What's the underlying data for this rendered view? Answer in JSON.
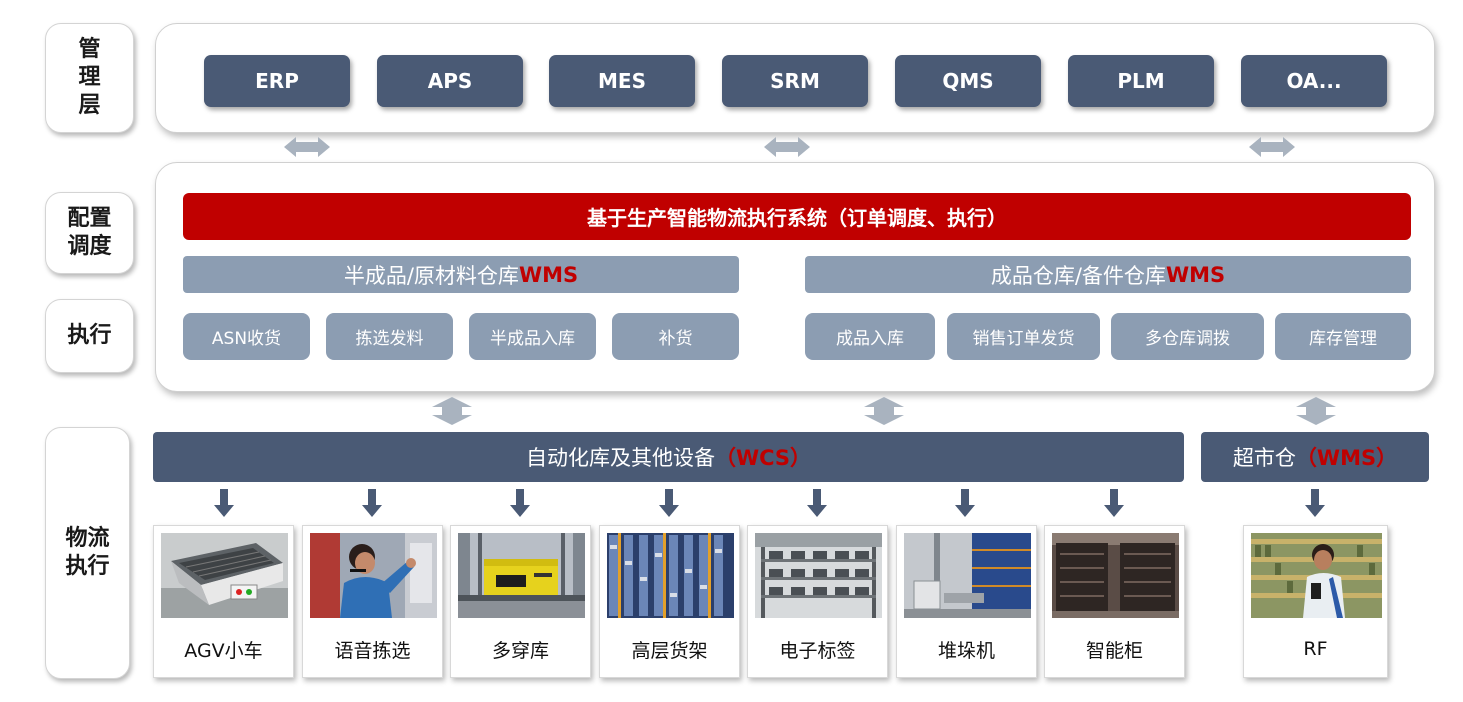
{
  "layers": {
    "management": "管\n理\n层",
    "config": "配置\n调度",
    "execute": "执行",
    "logistics": "物流\n执行"
  },
  "systems": [
    "ERP",
    "APS",
    "MES",
    "SRM",
    "QMS",
    "PLM",
    "OA..."
  ],
  "execution_system": {
    "title": "基于生产智能物流执行系统（订单调度、执行）",
    "left_wms": {
      "prefix": "半成品/原材料仓库",
      "suffix": "WMS"
    },
    "right_wms": {
      "prefix": "成品仓库/备件仓库",
      "suffix": "WMS"
    },
    "left_functions": [
      "ASN收货",
      "拣选发料",
      "半成品入库",
      "补货"
    ],
    "right_functions": [
      "成品入库",
      "销售订单发货",
      "多仓库调拨",
      "库存管理"
    ]
  },
  "wcs": {
    "prefix": "自动化库及其他设备",
    "suffix": "（WCS）"
  },
  "supermarket": {
    "prefix": "超市仓",
    "suffix": "（WMS）"
  },
  "devices": [
    "AGV小车",
    "语音拣选",
    "多穿库",
    "高层货架",
    "电子标签",
    "堆垛机",
    "智能柜"
  ],
  "rf_device": "RF",
  "colors": {
    "dark_slate": "#4a5a75",
    "light_slate": "#8c9db2",
    "accent_red": "#c00000",
    "arrow_grey": "#a9b3bf"
  },
  "icons": {
    "connector": "double-arrow-icon",
    "flow": "down-arrow-icon",
    "photos": [
      "agv-cart-photo",
      "voice-picking-photo",
      "shuttle-warehouse-photo",
      "high-rack-photo",
      "pick-to-light-photo",
      "stacker-crane-photo",
      "smart-cabinet-photo",
      "rf-scanner-photo"
    ]
  }
}
